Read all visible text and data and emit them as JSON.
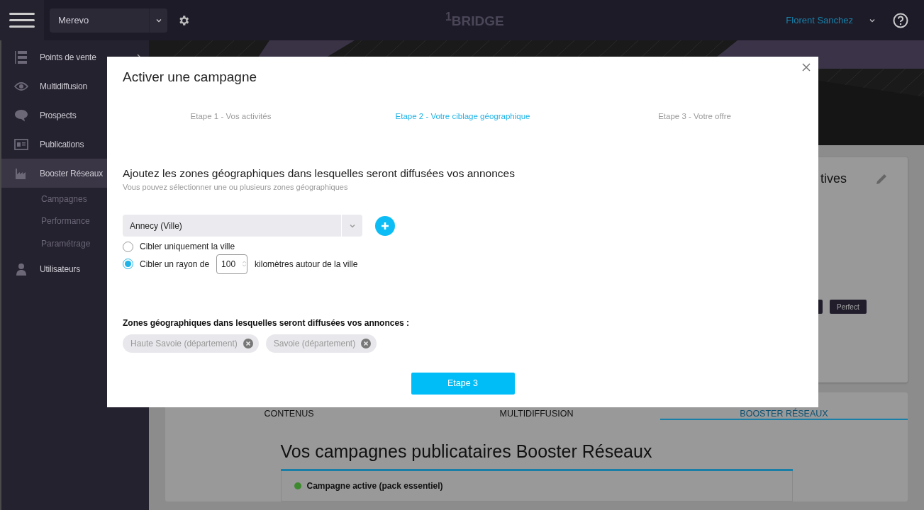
{
  "topbar": {
    "account": "Merevo",
    "logo": "$^{1}$BRIDGE",
    "user": "Florent Sanchez"
  },
  "sidebar": {
    "items": [
      {
        "label": "Points de vente",
        "kind": "list",
        "selected": false,
        "has_arrow": true
      },
      {
        "label": "Multidiffusion",
        "kind": "eye",
        "selected": false
      },
      {
        "label": "Prospects",
        "kind": "chat",
        "selected": false
      },
      {
        "label": "Publications",
        "kind": "news",
        "selected": false
      },
      {
        "label": "Booster Réseaux",
        "kind": "chart",
        "selected": true,
        "children": [
          {
            "label": "Campagnes"
          },
          {
            "label": "Performance"
          },
          {
            "label": "Paramétrage"
          }
        ]
      },
      {
        "label": "Utilisateurs",
        "kind": "user",
        "selected": false
      }
    ]
  },
  "background": {
    "card_title": "tives",
    "tags": [
      {
        "kind": "cut"
      },
      {
        "kind": "label",
        "label": "Perfect"
      }
    ],
    "tabs": [
      {
        "label": "CONTENUS",
        "selected": false
      },
      {
        "label": "MULTIDIFFUSION",
        "selected": false
      },
      {
        "label": "BOOSTER RÉSEAUX",
        "selected": true
      }
    ],
    "heading": "Vos campagnes publicataires Booster Réseaux",
    "campaign": {
      "label": "Campagne active (pack essentiel)",
      "color": "#3d8a2e"
    }
  },
  "modal": {
    "title": "Activer une campagne",
    "steps": [
      {
        "label": "Etape 1 - Vos activités",
        "selected": false
      },
      {
        "label": "Etape 2 - Votre ciblage géographique",
        "selected": true
      },
      {
        "label": "Etape 3 - Votre offre",
        "selected": false
      }
    ],
    "heading": "Ajoutez les zones géographiques dans lesquelles seront diffusées vos annonces",
    "subtitle": "Vous pouvez sélectionner une ou plusieurs zones géographiques",
    "city": "Annecy (Ville)",
    "options": [
      {
        "kind": "plain",
        "label": "Cibler uniquement la ville",
        "selected": false
      },
      {
        "kind": "radius",
        "label": "Cibler un rayon de",
        "value": "100",
        "suffix": "kilomètres autour de la ville",
        "selected": true
      }
    ],
    "zones_label": "Zones géographiques dans lesquelles seront diffusées vos annonces :",
    "zones": [
      "Haute Savoie (département)",
      "Savoie (département)"
    ],
    "button": "Etape 3"
  }
}
